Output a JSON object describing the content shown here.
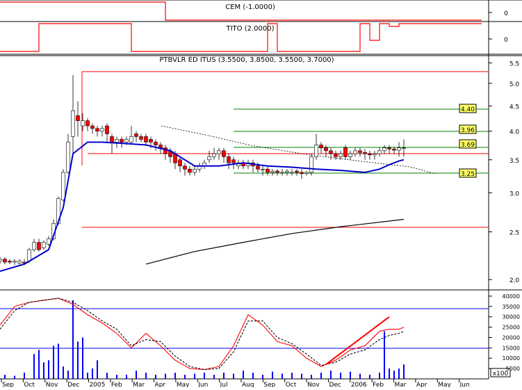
{
  "chart_data": [
    {
      "type": "line",
      "panel": "indicator",
      "title": "CEM (-1.0000)",
      "y_ticks": [
        0
      ],
      "series": [
        {
          "color": "#ff0000",
          "x": [
            0,
            0.33,
            0.34,
            0.83,
            0.99
          ],
          "values": [
            1,
            1,
            0,
            0,
            0
          ]
        }
      ]
    },
    {
      "type": "line",
      "panel": "indicator",
      "title": "TITO (2.0000)",
      "y_ticks": [
        0
      ],
      "series": [
        {
          "color": "#ff0000",
          "x": [
            0,
            0.06,
            0.08,
            0.25,
            0.27,
            0.53,
            0.55,
            0.57,
            0.72,
            0.74,
            0.76,
            0.78,
            0.8,
            0.82,
            0.84,
            0.99
          ],
          "values": [
            0,
            0,
            1,
            1,
            0,
            0,
            1,
            0,
            0,
            1,
            0.4,
            1,
            0.9,
            1,
            1,
            1
          ]
        }
      ]
    },
    {
      "type": "candlestick",
      "panel": "price",
      "title": "PTBVLR ED ITUS (3.5500, 3.8500, 3.5500, 3.7000)",
      "y_scale": "log",
      "ylim": [
        1.95,
        5.6
      ],
      "y_ticks": [
        2.0,
        2.5,
        3.0,
        3.5,
        4.0,
        4.5,
        5.0,
        5.5
      ],
      "x_labels": [
        "Sep",
        "Oct",
        "Nov",
        "Dec",
        "2005",
        "Feb",
        "Mar",
        "Apr",
        "May",
        "Jun",
        "Jul",
        "Aug",
        "Sep",
        "Oct",
        "Nov",
        "Dec",
        "2006",
        "Feb",
        "Mar",
        "Apr",
        "May",
        "Jun"
      ],
      "level_labels": [
        "4.40",
        "3.96",
        "3.69",
        "3.25"
      ],
      "series": [
        {
          "name": "close",
          "kind": "candles",
          "x": [
            0.0,
            0.01,
            0.02,
            0.03,
            0.04,
            0.05,
            0.06,
            0.07,
            0.08,
            0.09,
            0.1,
            0.11,
            0.12,
            0.13,
            0.14,
            0.15,
            0.16,
            0.17,
            0.18,
            0.19,
            0.2,
            0.21,
            0.22,
            0.23,
            0.24,
            0.25,
            0.26,
            0.27,
            0.28,
            0.29,
            0.3,
            0.31,
            0.32,
            0.33,
            0.34,
            0.35,
            0.36,
            0.37,
            0.38,
            0.39,
            0.4,
            0.41,
            0.42,
            0.43,
            0.44,
            0.45,
            0.46,
            0.47,
            0.48,
            0.49,
            0.5,
            0.51,
            0.52,
            0.53,
            0.54,
            0.55,
            0.56,
            0.57,
            0.58,
            0.59,
            0.6,
            0.61,
            0.62,
            0.63,
            0.64,
            0.65,
            0.66,
            0.67,
            0.68,
            0.69,
            0.7,
            0.71,
            0.72,
            0.73,
            0.74,
            0.75,
            0.76,
            0.77,
            0.78,
            0.79,
            0.8,
            0.81,
            0.82,
            0.83
          ],
          "open": [
            2.18,
            2.2,
            2.18,
            2.17,
            2.16,
            2.17,
            2.18,
            2.3,
            2.38,
            2.32,
            2.36,
            2.42,
            2.6,
            2.9,
            3.3,
            3.9,
            4.3,
            4.1,
            4.2,
            4.1,
            4.05,
            4.0,
            4.1,
            3.9,
            3.8,
            3.85,
            3.8,
            3.8,
            3.95,
            3.9,
            3.9,
            3.85,
            3.8,
            3.75,
            3.7,
            3.65,
            3.6,
            3.5,
            3.4,
            3.35,
            3.3,
            3.35,
            3.4,
            3.5,
            3.55,
            3.6,
            3.65,
            3.55,
            3.5,
            3.4,
            3.45,
            3.4,
            3.45,
            3.4,
            3.35,
            3.35,
            3.3,
            3.32,
            3.3,
            3.3,
            3.3,
            3.32,
            3.3,
            3.28,
            3.3,
            3.55,
            3.75,
            3.7,
            3.65,
            3.6,
            3.55,
            3.7,
            3.55,
            3.6,
            3.65,
            3.62,
            3.6,
            3.58,
            3.6,
            3.65,
            3.7,
            3.68,
            3.66,
            3.7
          ],
          "close": [
            2.2,
            2.17,
            2.17,
            2.18,
            2.18,
            2.16,
            2.3,
            2.38,
            2.3,
            2.38,
            2.42,
            2.6,
            2.92,
            3.3,
            3.8,
            4.4,
            4.2,
            4.2,
            4.1,
            4.05,
            4.0,
            4.05,
            3.95,
            3.8,
            3.85,
            3.8,
            3.85,
            3.9,
            3.9,
            3.85,
            3.8,
            3.8,
            3.75,
            3.7,
            3.6,
            3.55,
            3.45,
            3.4,
            3.35,
            3.3,
            3.35,
            3.4,
            3.45,
            3.55,
            3.6,
            3.65,
            3.55,
            3.45,
            3.45,
            3.45,
            3.4,
            3.45,
            3.4,
            3.35,
            3.35,
            3.3,
            3.32,
            3.3,
            3.3,
            3.32,
            3.3,
            3.3,
            3.28,
            3.3,
            3.55,
            3.75,
            3.7,
            3.65,
            3.6,
            3.55,
            3.6,
            3.55,
            3.6,
            3.65,
            3.62,
            3.6,
            3.58,
            3.6,
            3.65,
            3.7,
            3.68,
            3.66,
            3.7,
            3.7
          ],
          "high": [
            2.22,
            2.22,
            2.2,
            2.2,
            2.2,
            2.2,
            2.32,
            2.42,
            2.42,
            2.4,
            2.45,
            2.65,
            2.95,
            3.35,
            3.95,
            5.2,
            4.6,
            4.35,
            4.25,
            4.15,
            4.1,
            4.1,
            4.15,
            3.95,
            3.9,
            3.9,
            3.9,
            4.1,
            4.0,
            3.95,
            3.95,
            3.9,
            3.85,
            3.8,
            3.75,
            3.7,
            3.65,
            3.55,
            3.45,
            3.4,
            3.4,
            3.45,
            3.5,
            3.65,
            3.7,
            3.7,
            3.7,
            3.6,
            3.55,
            3.5,
            3.5,
            3.5,
            3.5,
            3.45,
            3.4,
            3.4,
            3.35,
            3.35,
            3.35,
            3.35,
            3.35,
            3.35,
            3.35,
            3.32,
            3.6,
            3.95,
            3.8,
            3.75,
            3.7,
            3.65,
            3.65,
            3.75,
            3.65,
            3.7,
            3.7,
            3.68,
            3.65,
            3.65,
            3.7,
            3.75,
            3.75,
            3.72,
            3.8,
            3.85
          ],
          "low": [
            2.15,
            2.15,
            2.15,
            2.14,
            2.14,
            2.14,
            2.16,
            2.28,
            2.28,
            2.3,
            2.34,
            2.4,
            2.58,
            2.88,
            3.28,
            3.6,
            3.9,
            4.0,
            4.0,
            3.95,
            3.9,
            3.9,
            3.8,
            3.6,
            3.7,
            3.7,
            3.75,
            3.75,
            3.8,
            3.8,
            3.75,
            3.7,
            3.65,
            3.6,
            3.5,
            3.45,
            3.35,
            3.3,
            3.25,
            3.25,
            3.25,
            3.3,
            3.35,
            3.45,
            3.5,
            3.5,
            3.45,
            3.35,
            3.35,
            3.35,
            3.35,
            3.35,
            3.3,
            3.3,
            3.25,
            3.25,
            3.25,
            3.25,
            3.25,
            3.25,
            3.25,
            3.25,
            3.2,
            3.25,
            3.25,
            3.5,
            3.6,
            3.55,
            3.5,
            3.5,
            3.5,
            3.5,
            3.5,
            3.55,
            3.55,
            3.5,
            3.5,
            3.5,
            3.55,
            3.6,
            3.6,
            3.6,
            3.55,
            3.55
          ]
        },
        {
          "name": "ma-fast",
          "color": "#0000cc",
          "x": [
            0.0,
            0.05,
            0.1,
            0.13,
            0.15,
            0.18,
            0.21,
            0.25,
            0.3,
            0.35,
            0.4,
            0.45,
            0.5,
            0.55,
            0.6,
            0.65,
            0.7,
            0.75,
            0.78,
            0.8,
            0.82,
            0.83
          ],
          "values": [
            2.08,
            2.15,
            2.3,
            2.8,
            3.6,
            3.8,
            3.8,
            3.78,
            3.75,
            3.65,
            3.4,
            3.4,
            3.45,
            3.4,
            3.38,
            3.35,
            3.33,
            3.3,
            3.35,
            3.42,
            3.48,
            3.5
          ]
        },
        {
          "name": "ma-slow",
          "color": "#000000",
          "x": [
            0.3,
            0.4,
            0.5,
            0.6,
            0.7,
            0.83
          ],
          "values": [
            2.15,
            2.28,
            2.38,
            2.48,
            2.56,
            2.65
          ]
        }
      ]
    },
    {
      "type": "bar",
      "panel": "volume",
      "y_ticks": [
        5000,
        10000,
        15000,
        20000,
        25000,
        30000,
        35000,
        40000
      ],
      "ylim": [
        0,
        42000
      ],
      "x_labels": [
        "Sep",
        "Oct",
        "Nov",
        "Dec",
        "2005",
        "Feb",
        "Mar",
        "Apr",
        "May",
        "Jun",
        "Jul",
        "Aug",
        "Sep",
        "Oct",
        "Nov",
        "Dec",
        "2006",
        "Feb",
        "Mar",
        "Apr",
        "May",
        "Jun"
      ],
      "hlines": [
        32500,
        13500
      ],
      "volume": {
        "x": [
          0.01,
          0.03,
          0.05,
          0.07,
          0.08,
          0.09,
          0.1,
          0.11,
          0.12,
          0.13,
          0.14,
          0.15,
          0.16,
          0.17,
          0.18,
          0.19,
          0.2,
          0.22,
          0.24,
          0.26,
          0.28,
          0.3,
          0.32,
          0.34,
          0.36,
          0.38,
          0.4,
          0.42,
          0.44,
          0.46,
          0.48,
          0.5,
          0.52,
          0.54,
          0.56,
          0.58,
          0.6,
          0.62,
          0.64,
          0.66,
          0.68,
          0.7,
          0.72,
          0.74,
          0.76,
          0.78,
          0.79,
          0.8,
          0.81,
          0.82,
          0.83
        ],
        "values": [
          2000,
          1500,
          3000,
          12000,
          14000,
          8000,
          9000,
          16000,
          17000,
          6000,
          4000,
          38000,
          18000,
          20000,
          3000,
          5000,
          9000,
          3000,
          2000,
          2000,
          4000,
          3000,
          2000,
          2500,
          3000,
          2000,
          2500,
          3000,
          2000,
          3000,
          2500,
          4000,
          3000,
          2000,
          3500,
          2500,
          3000,
          2500,
          2000,
          3000,
          4000,
          3000,
          3500,
          2500,
          2000,
          3000,
          23000,
          5000,
          4000,
          5000,
          7000
        ]
      },
      "series": [
        {
          "color": "#ff0000",
          "x": [
            0.0,
            0.03,
            0.06,
            0.09,
            0.12,
            0.15,
            0.18,
            0.21,
            0.24,
            0.27,
            0.3,
            0.33,
            0.36,
            0.39,
            0.42,
            0.45,
            0.48,
            0.51,
            0.54,
            0.57,
            0.6,
            0.63,
            0.66,
            0.69,
            0.72,
            0.75,
            0.78,
            0.8,
            0.82,
            0.83
          ],
          "values": [
            26000,
            35000,
            37000,
            38000,
            39000,
            36000,
            31000,
            27000,
            22000,
            15000,
            22000,
            16000,
            9000,
            5000,
            4500,
            6000,
            16000,
            31000,
            26000,
            18000,
            16000,
            10000,
            6000,
            9000,
            14000,
            16000,
            23000,
            24000,
            24000,
            25000
          ]
        },
        {
          "color": "#000000",
          "x": [
            0.0,
            0.03,
            0.06,
            0.09,
            0.12,
            0.15,
            0.18,
            0.21,
            0.24,
            0.27,
            0.3,
            0.33,
            0.36,
            0.39,
            0.42,
            0.45,
            0.48,
            0.51,
            0.54,
            0.57,
            0.6,
            0.63,
            0.66,
            0.69,
            0.72,
            0.75,
            0.78,
            0.8,
            0.82,
            0.83
          ],
          "values": [
            24000,
            33000,
            37000,
            38000,
            39000,
            37000,
            33000,
            28000,
            24000,
            16000,
            19000,
            18000,
            11000,
            6000,
            4500,
            5000,
            13000,
            28000,
            28000,
            20000,
            17000,
            12000,
            6500,
            8000,
            12000,
            14000,
            19000,
            21000,
            22000,
            23000
          ]
        },
        {
          "color": "#ff0000",
          "x": [
            0.67,
            0.8
          ],
          "values": [
            7000,
            30000
          ]
        }
      ],
      "corner_label": "x100"
    }
  ]
}
